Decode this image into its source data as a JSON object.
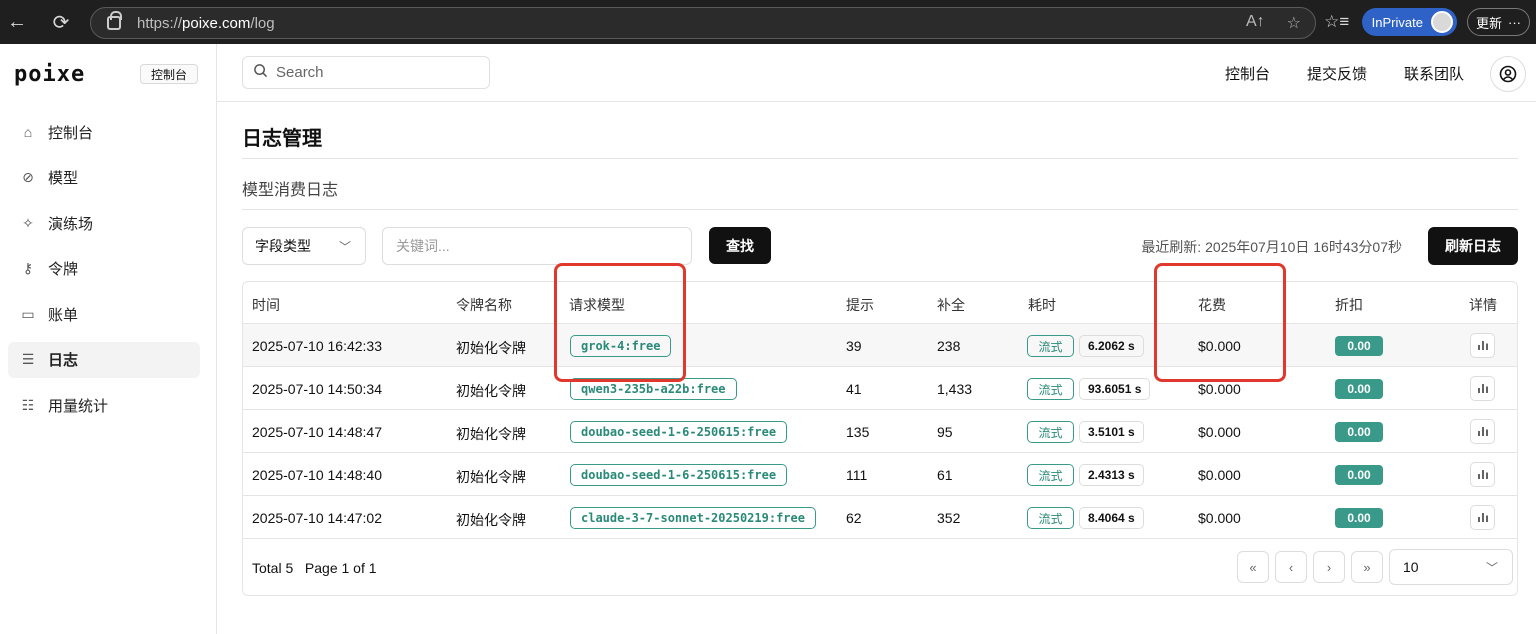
{
  "browser": {
    "url_prefix": "https://",
    "url_domain": "poixe.com",
    "url_path": "/log",
    "inprivate_label": "InPrivate",
    "update_label": "更新"
  },
  "app": {
    "brand": "poixe",
    "console_badge": "控制台",
    "search_placeholder": "Search",
    "topnav": [
      "控制台",
      "提交反馈",
      "联系团队"
    ]
  },
  "sidebar": {
    "items": [
      {
        "label": "控制台",
        "icon": "home-icon"
      },
      {
        "label": "模型",
        "icon": "model-icon"
      },
      {
        "label": "演练场",
        "icon": "sparkle-icon"
      },
      {
        "label": "令牌",
        "icon": "key-icon"
      },
      {
        "label": "账单",
        "icon": "card-icon"
      },
      {
        "label": "日志",
        "icon": "list-icon"
      },
      {
        "label": "用量统计",
        "icon": "stats-icon"
      }
    ]
  },
  "main": {
    "title": "日志管理",
    "subtitle": "模型消费日志",
    "field_type_label": "字段类型",
    "keyword_placeholder": "关键词...",
    "find_label": "查找",
    "last_refresh": "最近刷新: 2025年07月10日 16时43分07秒",
    "refresh_label": "刷新日志"
  },
  "table": {
    "columns": [
      "时间",
      "令牌名称",
      "请求模型",
      "提示",
      "补全",
      "耗时",
      "花费",
      "折扣",
      "详情"
    ],
    "rows": [
      {
        "time": "2025-07-10 16:42:33",
        "token": "初始化令牌",
        "model": "grok-4:free",
        "prompt": "39",
        "completion": "238",
        "stream": "流式",
        "duration": "6.2062 s",
        "cost": "$0.000",
        "discount": "0.00"
      },
      {
        "time": "2025-07-10 14:50:34",
        "token": "初始化令牌",
        "model": "qwen3-235b-a22b:free",
        "prompt": "41",
        "completion": "1,433",
        "stream": "流式",
        "duration": "93.6051 s",
        "cost": "$0.000",
        "discount": "0.00"
      },
      {
        "time": "2025-07-10 14:48:47",
        "token": "初始化令牌",
        "model": "doubao-seed-1-6-250615:free",
        "prompt": "135",
        "completion": "95",
        "stream": "流式",
        "duration": "3.5101 s",
        "cost": "$0.000",
        "discount": "0.00"
      },
      {
        "time": "2025-07-10 14:48:40",
        "token": "初始化令牌",
        "model": "doubao-seed-1-6-250615:free",
        "prompt": "111",
        "completion": "61",
        "stream": "流式",
        "duration": "2.4313 s",
        "cost": "$0.000",
        "discount": "0.00"
      },
      {
        "time": "2025-07-10 14:47:02",
        "token": "初始化令牌",
        "model": "claude-3-7-sonnet-20250219:free",
        "prompt": "62",
        "completion": "352",
        "stream": "流式",
        "duration": "8.4064 s",
        "cost": "$0.000",
        "discount": "0.00"
      }
    ],
    "total": "Total 5",
    "page": "Page 1 of 1",
    "page_size": "10"
  },
  "colors": {
    "accent_teal": "#3a9a8a",
    "annotation_red": "#e0382c"
  }
}
